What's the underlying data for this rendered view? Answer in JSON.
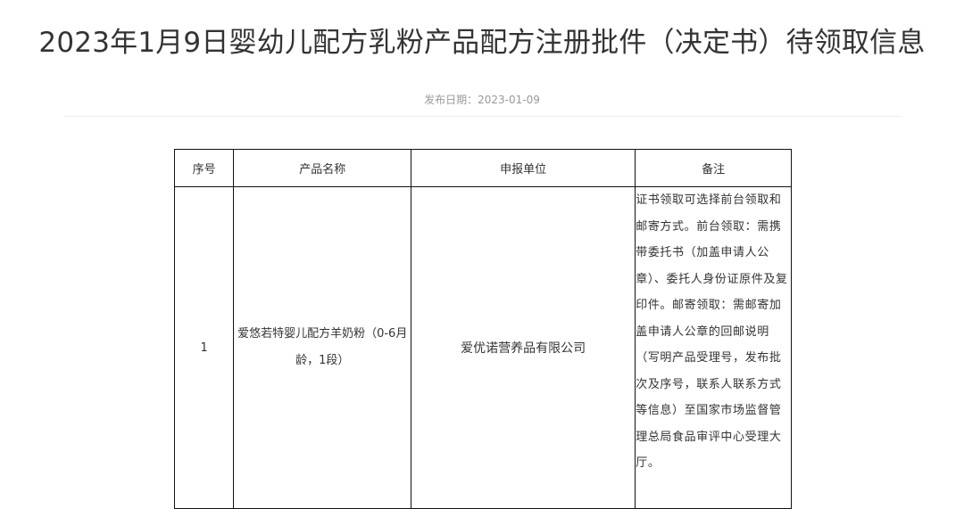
{
  "article": {
    "title": "2023年1月9日婴幼儿配方乳粉产品配方注册批件（决定书）待领取信息",
    "date_label": "发布日期：2023-01-09"
  },
  "table": {
    "headers": {
      "no": "序号",
      "name": "产品名称",
      "unit": "申报单位",
      "note": "备注"
    },
    "rows": [
      {
        "no": "1",
        "name": "爱悠若特婴儿配方羊奶粉（0-6月龄，1段）",
        "unit": "爱优诺营养品有限公司",
        "note": "证书领取可选择前台领取和邮寄方式。前台领取：需携带委托书（加盖申请人公章）、委托人身份证原件及复印件。邮寄领取：需邮寄加盖申请人公章的回邮说明（写明产品受理号，发布批次及序号，联系人联系方式等信息）至国家市场监督管理总局食品审评中心受理大厅。"
      }
    ]
  }
}
